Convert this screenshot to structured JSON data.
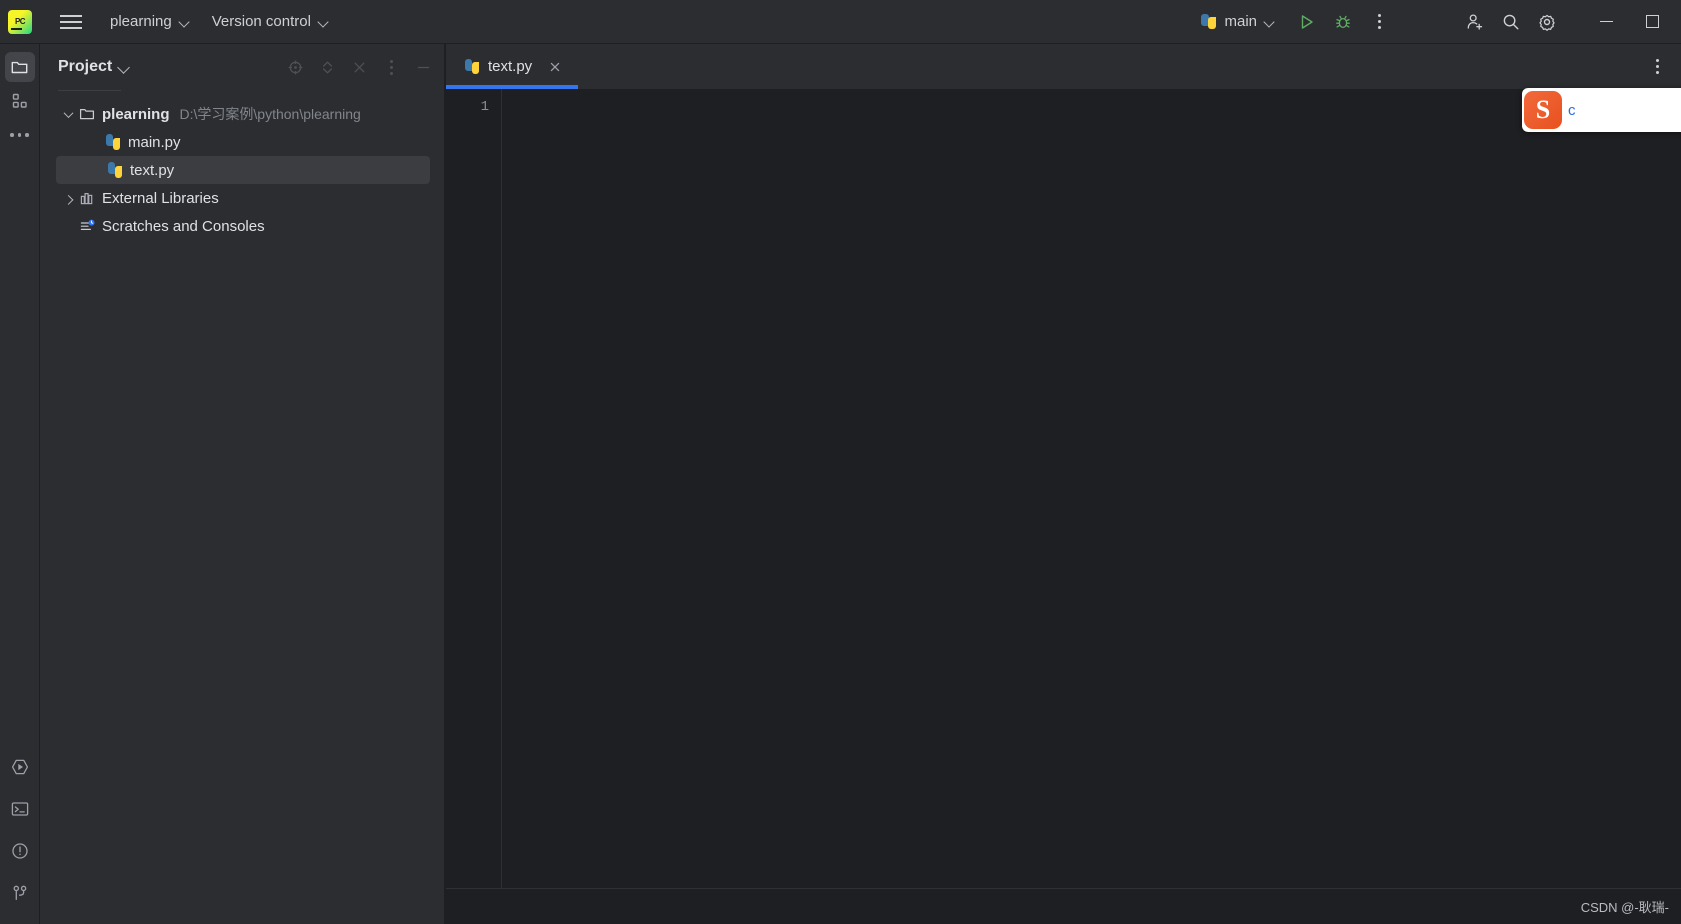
{
  "app": {
    "logo_text": "PC",
    "logo_name": "pycharm-logo-icon"
  },
  "toolbar": {
    "menu_icon": "hamburger-menu-icon",
    "project_name": "plearning",
    "version_control": "Version control",
    "run_config_name": "main",
    "run_icon": "run-icon",
    "debug_icon": "debug-icon",
    "more_icon": "more-actions-icon",
    "account_icon": "add-account-icon",
    "search_icon": "search-everywhere-icon",
    "settings_icon": "settings-gear-icon",
    "minimize_icon": "minimize-icon",
    "maximize_icon": "maximize-icon"
  },
  "activitybar": {
    "top": [
      {
        "name": "project-tool-icon",
        "label": "Project",
        "active": true
      },
      {
        "name": "structure-tool-icon",
        "label": "Structure",
        "active": false
      },
      {
        "name": "more-tool-windows-icon",
        "label": "More tool windows",
        "active": false
      }
    ],
    "bottom": [
      {
        "name": "run-tool-icon",
        "label": "Run"
      },
      {
        "name": "terminal-tool-icon",
        "label": "Terminal"
      },
      {
        "name": "problems-tool-icon",
        "label": "Problems"
      },
      {
        "name": "version-control-tool-icon",
        "label": "Version Control"
      }
    ]
  },
  "project_panel": {
    "title": "Project",
    "title_chevron": "chevron-down-icon",
    "tools": [
      {
        "name": "locate-file-icon",
        "label": "Select Opened File"
      },
      {
        "name": "expand-collapse-icon",
        "label": "Expand All"
      },
      {
        "name": "collapse-all-icon",
        "label": "Collapse All"
      },
      {
        "name": "panel-options-icon",
        "label": "Options"
      },
      {
        "name": "hide-panel-icon",
        "label": "Hide"
      }
    ],
    "tree": [
      {
        "name": "tree-node-plearning",
        "label": "plearning",
        "sublabel": "D:\\学习案例\\python\\plearning",
        "icon": "folder-icon",
        "depth": 0,
        "twisty": "open",
        "bold": true,
        "selected": false
      },
      {
        "name": "tree-node-main-py",
        "label": "main.py",
        "sublabel": "",
        "icon": "python-file-icon",
        "depth": 1,
        "twisty": "none",
        "bold": false,
        "selected": false
      },
      {
        "name": "tree-node-text-py",
        "label": "text.py",
        "sublabel": "",
        "icon": "python-file-icon",
        "depth": 1,
        "twisty": "none",
        "bold": false,
        "selected": true
      },
      {
        "name": "tree-node-external-libraries",
        "label": "External Libraries",
        "sublabel": "",
        "icon": "library-icon",
        "depth": 0,
        "twisty": "closed",
        "bold": false,
        "selected": false
      },
      {
        "name": "tree-node-scratches-and-consoles",
        "label": "Scratches and Consoles",
        "sublabel": "",
        "icon": "scratches-icon",
        "depth": 0,
        "twisty": "none",
        "bold": false,
        "selected": false
      }
    ]
  },
  "editor": {
    "tabs": [
      {
        "name": "editor-tab-text-py",
        "label": "text.py",
        "icon": "python-file-icon",
        "active": true,
        "close_icon": "close-icon"
      }
    ],
    "tab_options_icon": "editor-options-icon",
    "line_numbers": [
      "1"
    ],
    "lines": [
      ""
    ],
    "accent_color": "#3574f0"
  },
  "statusbar": {
    "watermark": "CSDN @-耿瑞-"
  },
  "ime_popup": {
    "logo_letter": "S",
    "logo_name": "sogou-ime-logo-icon",
    "text": "c"
  },
  "colors": {
    "toolbar_bg": "#2b2d30",
    "editor_bg": "#1e1f22",
    "selection_bg": "#3b3d40",
    "text": "#dfe1e5",
    "muted_text": "#82858c",
    "accent": "#3574f0",
    "run_green": "#5fad65"
  }
}
